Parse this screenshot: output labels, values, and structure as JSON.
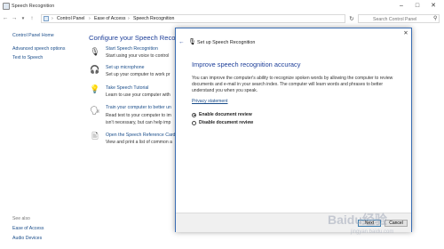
{
  "window": {
    "title": "Speech Recognition",
    "app_icon": "speech-recognition-icon",
    "controls": [
      "minimize-icon",
      "maximize-icon",
      "close-icon"
    ]
  },
  "address_bar": {
    "crumbs": [
      "Control Panel",
      "Ease of Access",
      "Speech Recognition"
    ],
    "search_placeholder": "Search Control Panel"
  },
  "left_nav": {
    "items": [
      {
        "label": "Control Panel Home"
      },
      {
        "label": "Advanced speech options"
      },
      {
        "label": "Text to Speech"
      }
    ],
    "see_also_heading": "See also",
    "see_also": [
      {
        "label": "Ease of Access"
      },
      {
        "label": "Audio Devices"
      }
    ]
  },
  "main": {
    "title": "Configure your Speech Recognit",
    "options": [
      {
        "icon": "microphone-icon",
        "link": "Start Speech Recognition",
        "desc": "Start using your voice to control"
      },
      {
        "icon": "headset-icon",
        "link": "Set up microphone",
        "desc": "Set up your computer to work pr"
      },
      {
        "icon": "lightbulb-icon",
        "link": "Take Speech Tutorial",
        "desc": "Learn to use your computer with"
      },
      {
        "icon": "train-voice-icon",
        "link": "Train your computer to better un",
        "desc": "Read text to your computer to im",
        "desc2": "isn't necessary, but can help imp"
      },
      {
        "icon": "reference-card-icon",
        "link": "Open the Speech Reference Card",
        "desc": "View and print a list of common a"
      }
    ]
  },
  "dialog": {
    "title": "Set up Speech Recognition",
    "heading": "Improve speech recognition accuracy",
    "body_lines": [
      "You can improve the computer's ability to recognize spoken words by allowing the computer to review",
      "documents and e-mail in your search index. The computer will learn words and phrases to better",
      "understand you when you speak."
    ],
    "privacy_link": "Privacy statement",
    "radio_options": [
      {
        "label": "Enable document review",
        "selected": true
      },
      {
        "label": "Disable document review",
        "selected": false
      }
    ],
    "buttons": {
      "next": "Next",
      "cancel": "Cancel"
    }
  },
  "watermark": {
    "text": "Baidu经验",
    "url_text": "jingyan.baidu.com"
  },
  "colors": {
    "link": "#1a4d8a",
    "heading": "#1e3f99",
    "dialog_border": "#3a6db3"
  }
}
